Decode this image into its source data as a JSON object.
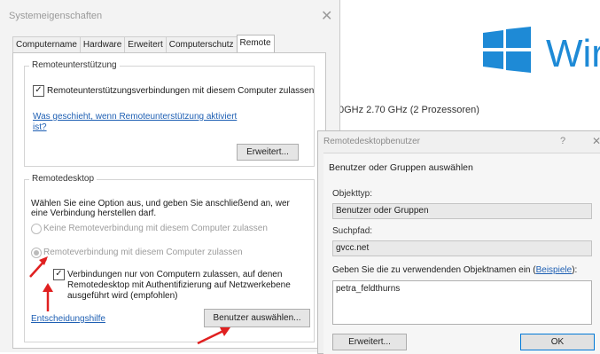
{
  "background_window": {
    "logo_text": "Wir",
    "cpu_text": "0GHz   2.70 GHz  (2 Prozessoren)"
  },
  "system_properties": {
    "title": "Systemeigenschaften",
    "close_glyph": "✕",
    "tabs": [
      {
        "label": "Computername"
      },
      {
        "label": "Hardware"
      },
      {
        "label": "Erweitert"
      },
      {
        "label": "Computerschutz"
      },
      {
        "label": "Remote"
      }
    ],
    "remote_assistance": {
      "legend": "Remoteunterstützung",
      "checkbox_label": "Remoteunterstützungsverbindungen mit diesem Computer zulassen",
      "link_line1": "Was geschieht, wenn Remoteunterstützung aktiviert",
      "link_line2": "ist?",
      "advanced_button": "Erweitert..."
    },
    "remote_desktop": {
      "legend": "Remotedesktop",
      "intro_line1": "Wählen Sie eine Option aus, und geben Sie anschließend an, wer",
      "intro_line2": "eine Verbindung herstellen darf.",
      "option_disallow": "Keine Remoteverbindung mit diesem Computer zulassen",
      "option_allow": "Remoteverbindung mit diesem Computer zulassen",
      "nla_line1": "Verbindungen nur von Computern zulassen, auf denen",
      "nla_line2": "Remotedesktop mit Authentifizierung auf Netzwerkebene",
      "nla_line3": "ausgeführt wird (empfohlen)",
      "help_link": "Entscheidungshilfe",
      "select_users_button": "Benutzer auswählen..."
    }
  },
  "remote_desktop_users": {
    "title": "Remotedesktopbenutzer",
    "help_glyph": "?",
    "close_glyph": "✕",
    "subtitle": "Benutzer oder Gruppen auswählen",
    "object_type_label": "Objekttyp:",
    "object_type_value": "Benutzer oder Gruppen",
    "path_label": "Suchpfad:",
    "path_value": "gvcc.net",
    "object_names_label_prefix": "Geben Sie die zu verwendenden Objektnamen ein (",
    "object_names_label_link": "Beispiele",
    "object_names_label_suffix": "):",
    "object_names_value": "petra_feldthurns",
    "advanced_button": "Erweitert...",
    "ok_button": "OK"
  },
  "colors": {
    "windows_blue": "#1e8ad6",
    "annotation_red": "#e02020",
    "link_blue": "#1e5fb3"
  }
}
